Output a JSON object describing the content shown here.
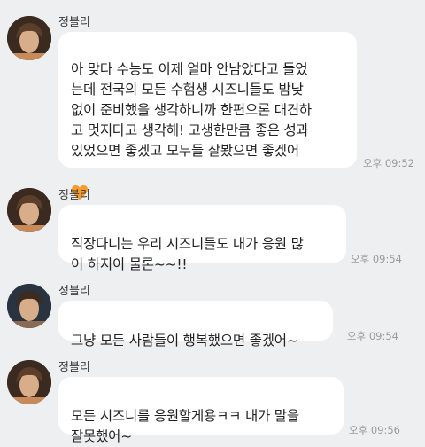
{
  "messages": [
    {
      "sender": "정블리",
      "text": "아 맞다 수능도 이제 얼마 안남았다고 들었\n는데 전국의 모든 수험생 시즈니들도 밤낮\n없이 준비했을 생각하니까 한편으론 대견하\n고 멋지다고 생각해! 고생한만큼 좋은 성과\n있었으면 좋겠고 모두들 잘봤으면 좋겠어",
      "emoji": "orange-heart-icon",
      "time": "오후 09:52"
    },
    {
      "sender": "정블리",
      "text": "직장다니는 우리 시즈니들도 내가 응원 많\n이 하지이 물론~~!!",
      "time": "오후 09:54"
    },
    {
      "sender": "정블리",
      "text": "그냥 모든 사람들이 행복했으면 좋겠어~",
      "time": "오후 09:54"
    },
    {
      "sender": "정블리",
      "text": "모든 시즈니를 응원할게용ㅋㅋ 내가 말을\n잘못했어~",
      "time": "오후 09:56"
    }
  ],
  "colors": {
    "background": "#eeeff1",
    "bubble": "#ffffff",
    "heart": "#f59a2b"
  }
}
